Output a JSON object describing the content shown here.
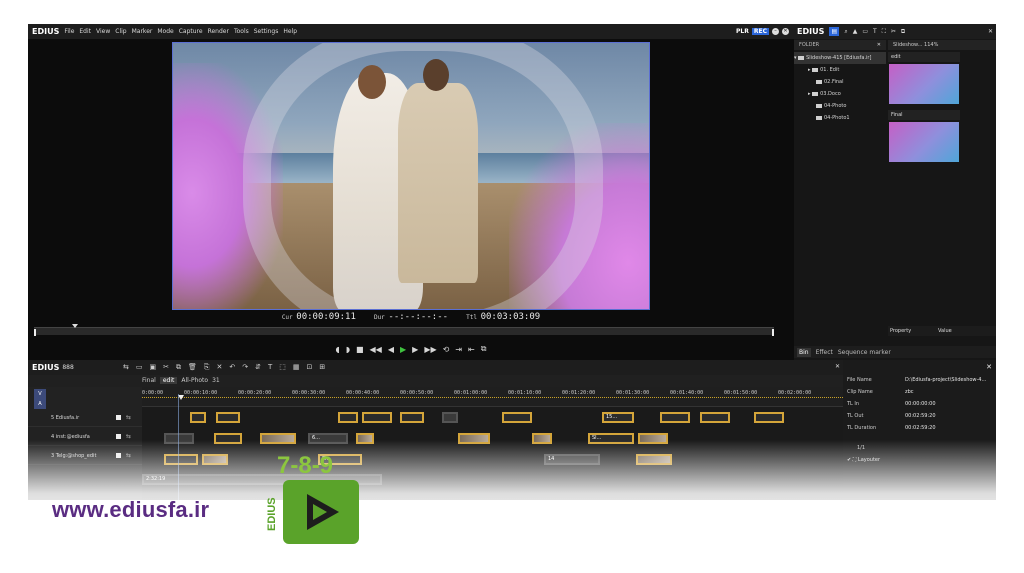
{
  "player": {
    "app_name": "EDIUS",
    "menu": [
      "File",
      "Edit",
      "View",
      "Clip",
      "Marker",
      "Mode",
      "Capture",
      "Render",
      "Tools",
      "Settings",
      "Help"
    ],
    "plr": "PLR",
    "rec": "REC",
    "cur_label": "Cur",
    "cur_tc": "00:00:09:11",
    "dur_label": "Dur",
    "dur_tc": "--:--:--:--",
    "ttl_label": "Ttl",
    "ttl_tc": "00:03:03:09"
  },
  "bin": {
    "app_name": "EDIUS",
    "folder_header": "FOLDER",
    "breadcrumb": "Slideshow...  114%",
    "tree": [
      "Slideshow-415 [Ediusfa.ir]",
      "01. Edit",
      "02.Final",
      "03.Doco",
      "04-Photo",
      "04-Photo1"
    ],
    "clips": [
      "edit",
      "Final"
    ],
    "prop_col": "Property",
    "value_col": "Value",
    "tabs": [
      "Bin",
      "Effect",
      "Sequence marker"
    ]
  },
  "timeline": {
    "app_name": "EDIUS",
    "project": "888",
    "seq_tabs": [
      "Final",
      "edit",
      "All-Photo",
      "31"
    ],
    "ruler": [
      "0:00:00",
      "00:00:10:00",
      "00:00:20:00",
      "00:00:30:00",
      "00:00:40:00",
      "00:00:50:00",
      "00:01:00:00",
      "00:01:10:00",
      "00:01:20:00",
      "00:01:30:00",
      "00:01:40:00",
      "00:01:50:00",
      "00:02:00:00"
    ],
    "tracks": [
      "5 Ediusfa.ir",
      "4 inst:@ediusfa",
      "3 Telg:@shop_edit"
    ],
    "track_va": [
      "V",
      "A"
    ],
    "clip_labels": [
      "15...",
      "Sl...",
      "6...",
      "14",
      "Sl...",
      "2:32:19"
    ]
  },
  "props": {
    "rows": [
      {
        "k": "File Name",
        "v": "D:\\Ediusfa-project\\Slideshow-4..."
      },
      {
        "k": "Clip Name",
        "v": "zbc"
      },
      {
        "k": "TL In",
        "v": "00:00:00:00"
      },
      {
        "k": "TL Out",
        "v": "00:02:59:20"
      },
      {
        "k": "TL Duration",
        "v": "00:02:59:20"
      }
    ],
    "count": "1/1",
    "layouter": "Layouter"
  },
  "branding": {
    "url": "www.ediusfa.ir",
    "version": "7-8-9",
    "logo_text": "EDIUS"
  }
}
